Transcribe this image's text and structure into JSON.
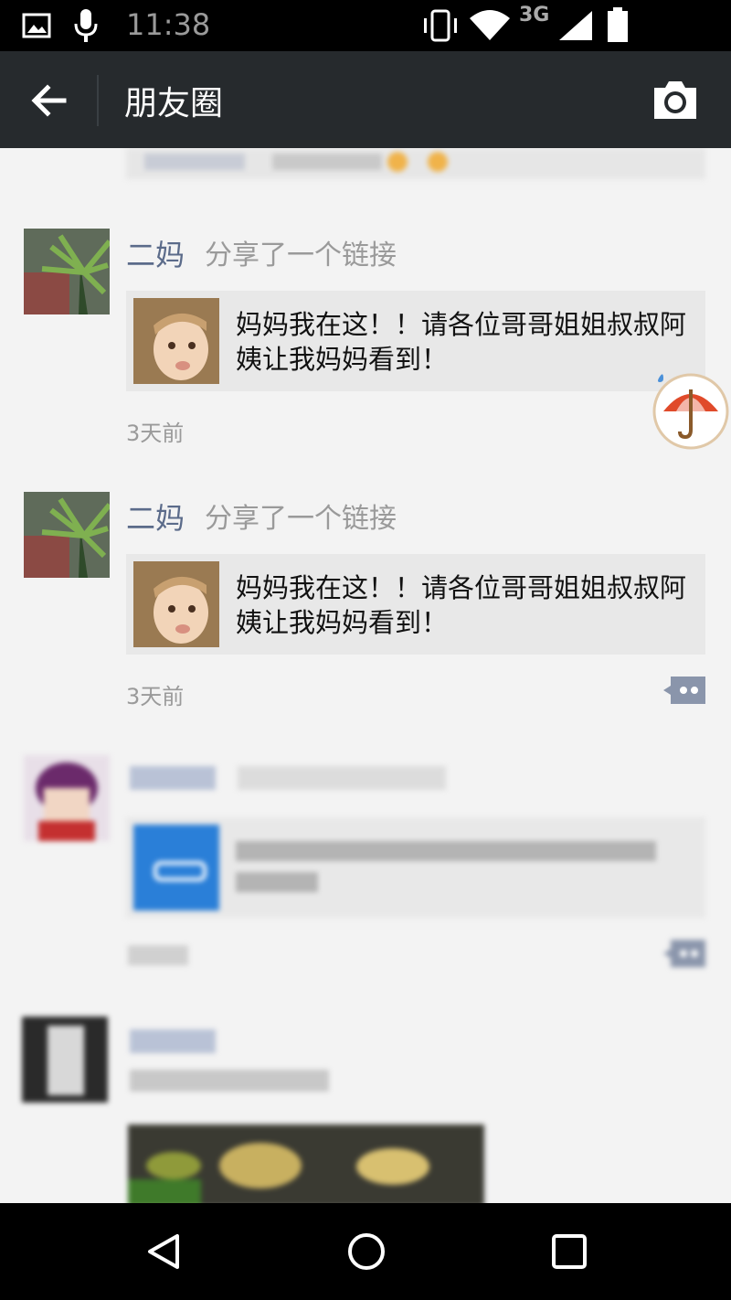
{
  "status_bar": {
    "network": "3G",
    "time": "11:38",
    "icons": [
      "image-icon",
      "mic-icon",
      "vibrate-icon",
      "wifi-icon",
      "signal-icon",
      "battery-icon"
    ]
  },
  "app_bar": {
    "title": "朋友圈",
    "back_icon": "back-arrow-icon",
    "camera_icon": "camera-icon"
  },
  "posts": [
    {
      "name": "二妈",
      "action": "分享了一个链接",
      "link_text": "妈妈我在这！！请各位哥哥姐姐叔叔阿姨让我妈妈看到！",
      "time": "3天前"
    },
    {
      "name": "二妈",
      "action": "分享了一个链接",
      "link_text": "妈妈我在这！！请各位哥哥姐姐叔叔阿姨让我妈妈看到！",
      "time": "3天前"
    }
  ],
  "nav_bar": {
    "buttons": [
      "back-triangle-icon",
      "home-circle-icon",
      "recents-square-icon"
    ]
  },
  "colors": {
    "app_bar_bg": "#262a2d",
    "name_color": "#5b6b8a",
    "feed_bg": "#f3f3f3"
  }
}
